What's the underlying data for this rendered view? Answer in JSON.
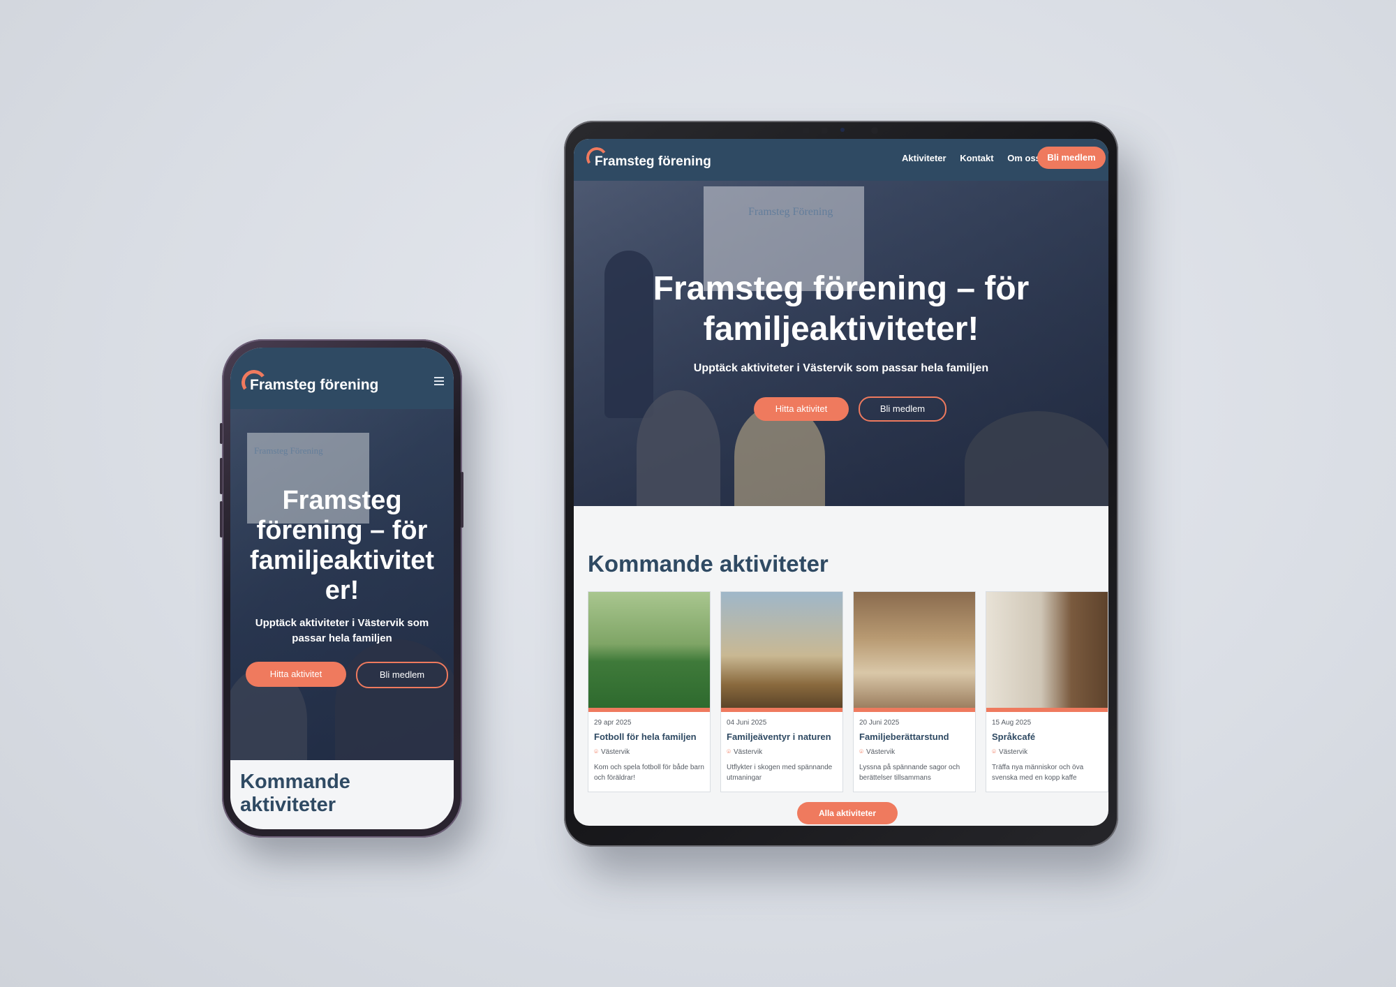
{
  "brand": {
    "name": "Framsteg förening",
    "accent": "#ef7a5e",
    "header_bg": "#2f4a63"
  },
  "nav": {
    "items": [
      "Aktiviteter",
      "Kontakt",
      "Om oss"
    ],
    "cta": "Bli medlem"
  },
  "hero": {
    "projector_text": "Framsteg Förening",
    "title_tablet": "Framsteg förening – för familjeaktiviteter!",
    "title_phone": "Framsteg förening – för familjeaktivitet er!",
    "subtitle": "Upptäck aktiviteter i Västervik som passar hela familjen",
    "primary_button": "Hitta aktivitet",
    "secondary_button": "Bli medlem"
  },
  "upcoming": {
    "title": "Kommande aktiviteter",
    "events": [
      {
        "date": "29 apr 2025",
        "title": "Fotboll för hela familjen",
        "location": "Västervik",
        "description": "Kom och spela fotboll för både barn och föräldrar!"
      },
      {
        "date": "04 Juni 2025",
        "title": "Familjeäventyr i naturen",
        "location": "Västervik",
        "description": "Utflykter i skogen med spännande utmaningar"
      },
      {
        "date": "20 Juni 2025",
        "title": "Familjeberättarstund",
        "location": "Västervik",
        "description": "Lyssna på spännande sagor och berättelser tillsammans"
      },
      {
        "date": "15 Aug 2025",
        "title": "Språkcafé",
        "location": "Västervik",
        "description": "Träffa nya människor och öva svenska med en kopp kaffe"
      }
    ],
    "all_button": "Alla aktiviteter"
  },
  "icons": {
    "menu": "hamburger-icon",
    "location": "map-pin-icon",
    "logo": "logo-arc-icon"
  }
}
